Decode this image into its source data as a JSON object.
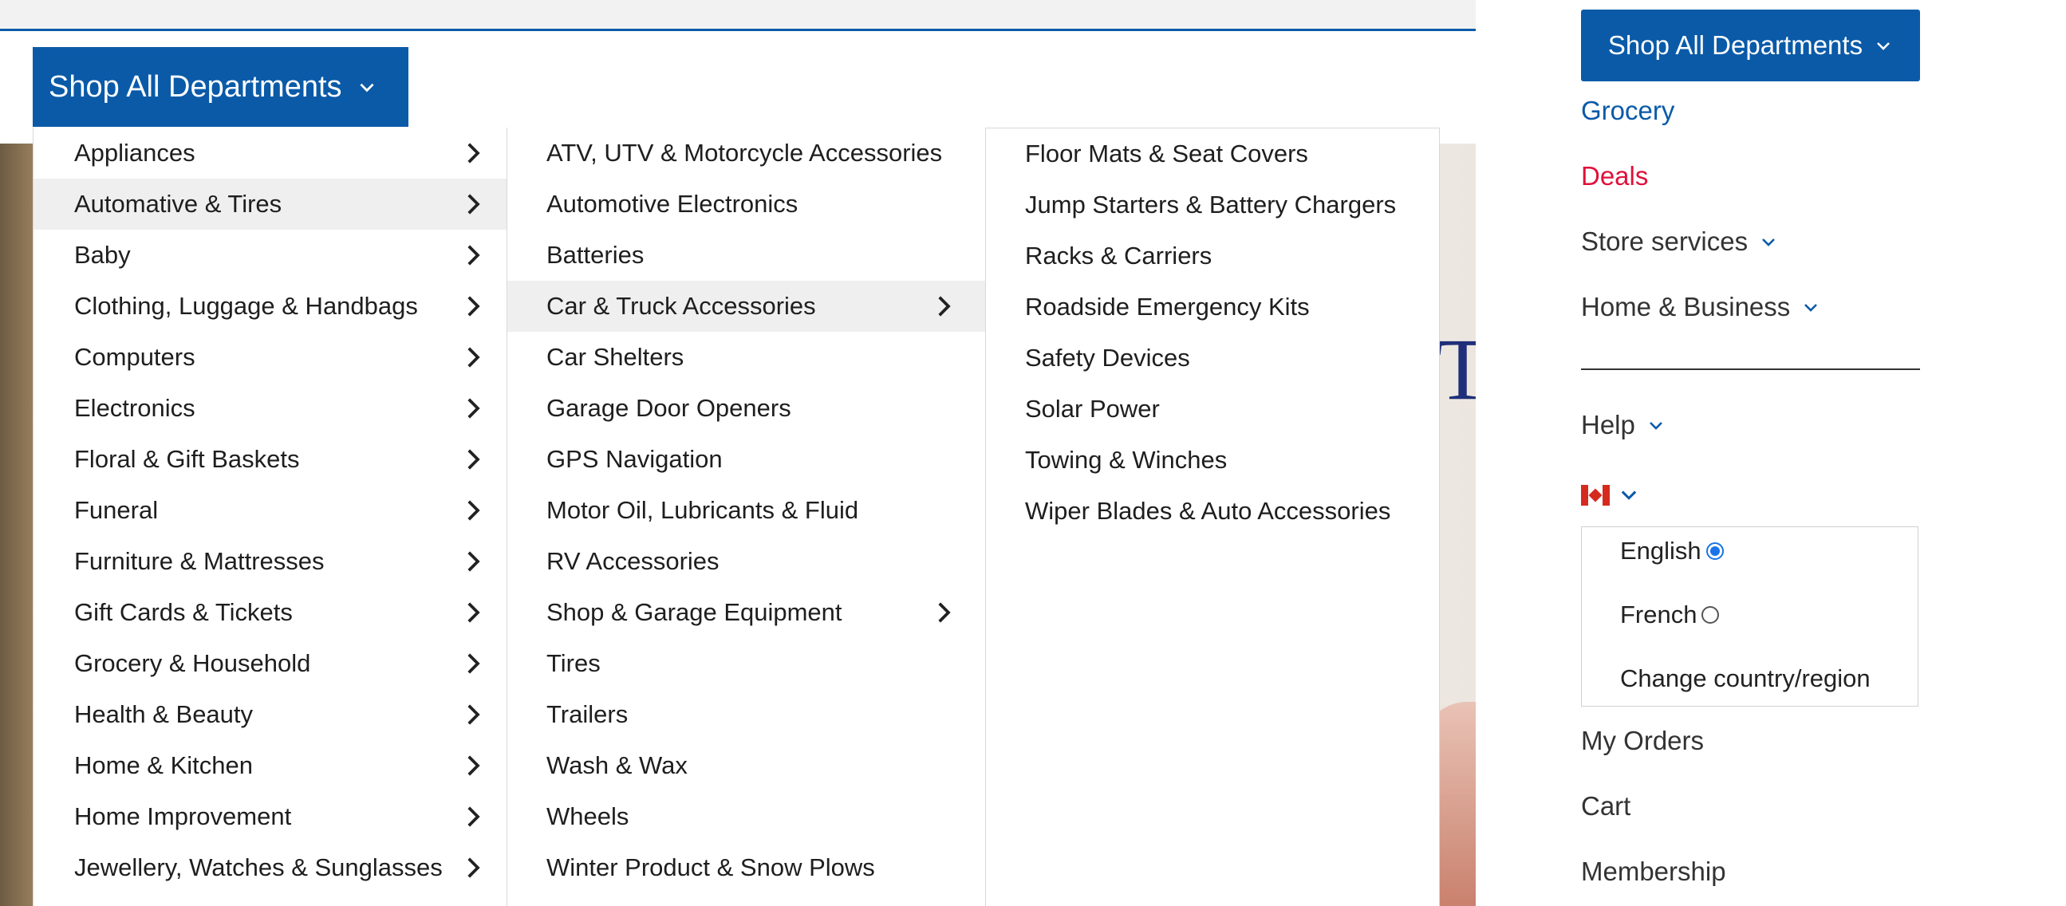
{
  "shop_button_label": "Shop All Departments",
  "hero_letters": "TI",
  "departments": [
    {
      "label": "Appliances",
      "active": false
    },
    {
      "label": "Automative & Tires",
      "active": true
    },
    {
      "label": "Baby",
      "active": false
    },
    {
      "label": "Clothing, Luggage & Handbags",
      "active": false
    },
    {
      "label": "Computers",
      "active": false
    },
    {
      "label": "Electronics",
      "active": false
    },
    {
      "label": "Floral & Gift Baskets",
      "active": false
    },
    {
      "label": "Funeral",
      "active": false
    },
    {
      "label": "Furniture & Mattresses",
      "active": false
    },
    {
      "label": "Gift Cards & Tickets",
      "active": false
    },
    {
      "label": "Grocery & Household",
      "active": false
    },
    {
      "label": "Health & Beauty",
      "active": false
    },
    {
      "label": "Home & Kitchen",
      "active": false
    },
    {
      "label": "Home Improvement",
      "active": false
    },
    {
      "label": "Jewellery, Watches & Sunglasses",
      "active": false
    }
  ],
  "subcategories": [
    {
      "label": "ATV, UTV & Motorcycle Accessories",
      "has_children": false,
      "active": false
    },
    {
      "label": "Automotive Electronics",
      "has_children": false,
      "active": false
    },
    {
      "label": "Batteries",
      "has_children": false,
      "active": false
    },
    {
      "label": "Car & Truck Accessories",
      "has_children": true,
      "active": true
    },
    {
      "label": "Car Shelters",
      "has_children": false,
      "active": false
    },
    {
      "label": "Garage Door Openers",
      "has_children": false,
      "active": false
    },
    {
      "label": "GPS Navigation",
      "has_children": false,
      "active": false
    },
    {
      "label": "Motor Oil, Lubricants & Fluid",
      "has_children": false,
      "active": false
    },
    {
      "label": "RV Accessories",
      "has_children": false,
      "active": false
    },
    {
      "label": "Shop & Garage Equipment",
      "has_children": true,
      "active": false
    },
    {
      "label": "Tires",
      "has_children": false,
      "active": false
    },
    {
      "label": "Trailers",
      "has_children": false,
      "active": false
    },
    {
      "label": "Wash & Wax",
      "has_children": false,
      "active": false
    },
    {
      "label": "Wheels",
      "has_children": false,
      "active": false
    },
    {
      "label": "Winter Product & Snow Plows",
      "has_children": false,
      "active": false
    }
  ],
  "sub_subcategories": [
    {
      "label": "Floor Mats & Seat Covers"
    },
    {
      "label": "Jump Starters & Battery Chargers"
    },
    {
      "label": "Racks & Carriers"
    },
    {
      "label": "Roadside Emergency Kits"
    },
    {
      "label": "Safety Devices"
    },
    {
      "label": "Solar Power"
    },
    {
      "label": "Towing & Winches"
    },
    {
      "label": "Wiper Blades & Auto Accessories"
    }
  ],
  "side_nav": {
    "grocery": "Grocery",
    "deals": "Deals",
    "store_services": "Store services",
    "home_business": "Home & Business",
    "help": "Help",
    "my_orders": "My Orders",
    "cart": "Cart",
    "membership": "Membership"
  },
  "language": {
    "options": [
      {
        "label": "English",
        "selected": true
      },
      {
        "label": "French",
        "selected": false
      }
    ],
    "change_country": "Change country/region"
  },
  "colors": {
    "brand_blue": "#0a5aa8",
    "deals_red": "#e0103a",
    "active_row": "#efefef",
    "radio_blue": "#1a73e8"
  },
  "icons": {
    "dropdown": "chevron-down-icon",
    "submenu": "chevron-right-icon",
    "country_flag": "canada-flag-icon"
  }
}
